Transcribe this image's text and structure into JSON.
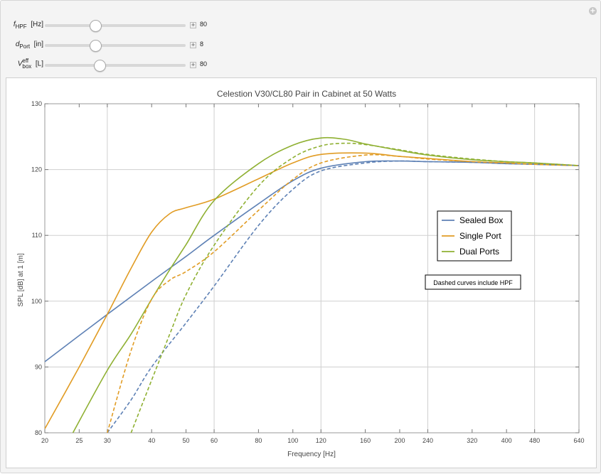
{
  "controls": [
    {
      "label_main": "f",
      "label_sub": "HPF",
      "label_sup": "",
      "unit": "[Hz]",
      "value": "80",
      "fraction": 0.36
    },
    {
      "label_main": "d",
      "label_sub": "Port",
      "label_sup": "",
      "unit": "[in]",
      "value": "8",
      "fraction": 0.36
    },
    {
      "label_main": "V",
      "label_sub": "box",
      "label_sup": "eff",
      "unit": "[L]",
      "value": "80",
      "fraction": 0.39
    }
  ],
  "chart_data": {
    "type": "line",
    "title": "Celestion V30/CL80 Pair in Cabinet at 50 Watts",
    "xlabel": "Frequency [Hz]",
    "ylabel": "SPL [dB] at 1 [m]",
    "x_scale": "log",
    "xlim": [
      20,
      640
    ],
    "ylim": [
      80,
      130
    ],
    "x_ticks": [
      20,
      25,
      30,
      40,
      50,
      60,
      80,
      100,
      120,
      160,
      200,
      240,
      320,
      400,
      480,
      640
    ],
    "x_tick_labels": [
      "20",
      "25",
      "30",
      "40",
      "50",
      "60",
      "80",
      "100",
      "120",
      "160",
      "200",
      "240",
      "320",
      "400",
      "480",
      "640"
    ],
    "x_grid": [
      30,
      60,
      120,
      240,
      480
    ],
    "y_ticks": [
      80,
      90,
      100,
      110,
      120,
      130
    ],
    "y_tick_labels": [
      "80",
      "90",
      "100",
      "110",
      "120",
      "130"
    ],
    "grid": true,
    "legend_position": "right",
    "note": "Dashed curves include HPF",
    "series": [
      {
        "name": "Sealed Box",
        "color": "#5e81b5",
        "dash": false,
        "points": [
          [
            20,
            90.8
          ],
          [
            30,
            98.0
          ],
          [
            40,
            103.0
          ],
          [
            50,
            106.8
          ],
          [
            60,
            110.0
          ],
          [
            80,
            114.8
          ],
          [
            100,
            118.3
          ],
          [
            120,
            120.2
          ],
          [
            160,
            121.2
          ],
          [
            200,
            121.3
          ],
          [
            240,
            121.2
          ],
          [
            320,
            121.1
          ],
          [
            400,
            120.9
          ],
          [
            480,
            120.8
          ],
          [
            640,
            120.6
          ]
        ]
      },
      {
        "name": "Single Port",
        "color": "#e19c24",
        "dash": false,
        "points": [
          [
            20,
            80.6
          ],
          [
            25,
            90.0
          ],
          [
            30,
            98.0
          ],
          [
            35,
            105.0
          ],
          [
            40,
            110.5
          ],
          [
            45,
            113.3
          ],
          [
            50,
            114.2
          ],
          [
            60,
            115.5
          ],
          [
            80,
            118.6
          ],
          [
            100,
            121.0
          ],
          [
            120,
            122.3
          ],
          [
            160,
            122.5
          ],
          [
            200,
            122.0
          ],
          [
            240,
            121.7
          ],
          [
            320,
            121.2
          ],
          [
            400,
            121.0
          ],
          [
            480,
            120.8
          ],
          [
            640,
            120.6
          ]
        ]
      },
      {
        "name": "Dual Ports",
        "color": "#8fb032",
        "dash": false,
        "points": [
          [
            24,
            80.0
          ],
          [
            30,
            89.5
          ],
          [
            35,
            95.0
          ],
          [
            40,
            100.3
          ],
          [
            45,
            104.8
          ],
          [
            50,
            108.6
          ],
          [
            60,
            115.3
          ],
          [
            80,
            120.9
          ],
          [
            100,
            123.7
          ],
          [
            120,
            124.8
          ],
          [
            140,
            124.6
          ],
          [
            160,
            123.9
          ],
          [
            200,
            122.9
          ],
          [
            240,
            122.2
          ],
          [
            320,
            121.5
          ],
          [
            400,
            121.2
          ],
          [
            480,
            121.0
          ],
          [
            640,
            120.6
          ]
        ]
      },
      {
        "name": "",
        "color": "#5e81b5",
        "dash": true,
        "points": [
          [
            30,
            80.0
          ],
          [
            35,
            85.0
          ],
          [
            40,
            90.0
          ],
          [
            50,
            96.7
          ],
          [
            60,
            102.3
          ],
          [
            80,
            111.5
          ],
          [
            100,
            117.0
          ],
          [
            120,
            119.8
          ],
          [
            160,
            121.0
          ],
          [
            200,
            121.3
          ],
          [
            240,
            121.2
          ],
          [
            320,
            121.1
          ],
          [
            400,
            120.9
          ],
          [
            480,
            120.8
          ],
          [
            640,
            120.6
          ]
        ]
      },
      {
        "name": "",
        "color": "#e19c24",
        "dash": true,
        "points": [
          [
            30,
            80.0
          ],
          [
            35,
            92.5
          ],
          [
            40,
            100.3
          ],
          [
            45,
            103.2
          ],
          [
            50,
            104.5
          ],
          [
            60,
            107.5
          ],
          [
            80,
            113.8
          ],
          [
            100,
            118.5
          ],
          [
            120,
            121.0
          ],
          [
            160,
            122.2
          ],
          [
            200,
            122.0
          ],
          [
            240,
            121.6
          ],
          [
            320,
            121.2
          ],
          [
            400,
            121.0
          ],
          [
            480,
            120.8
          ],
          [
            640,
            120.6
          ]
        ]
      },
      {
        "name": "",
        "color": "#8fb032",
        "dash": true,
        "points": [
          [
            35,
            80.0
          ],
          [
            40,
            88.0
          ],
          [
            45,
            95.0
          ],
          [
            50,
            101.0
          ],
          [
            60,
            108.5
          ],
          [
            80,
            117.5
          ],
          [
            100,
            121.8
          ],
          [
            120,
            123.6
          ],
          [
            140,
            124.0
          ],
          [
            160,
            123.8
          ],
          [
            200,
            123.0
          ],
          [
            240,
            122.3
          ],
          [
            320,
            121.6
          ],
          [
            400,
            121.2
          ],
          [
            480,
            121.0
          ],
          [
            640,
            120.6
          ]
        ]
      }
    ]
  }
}
